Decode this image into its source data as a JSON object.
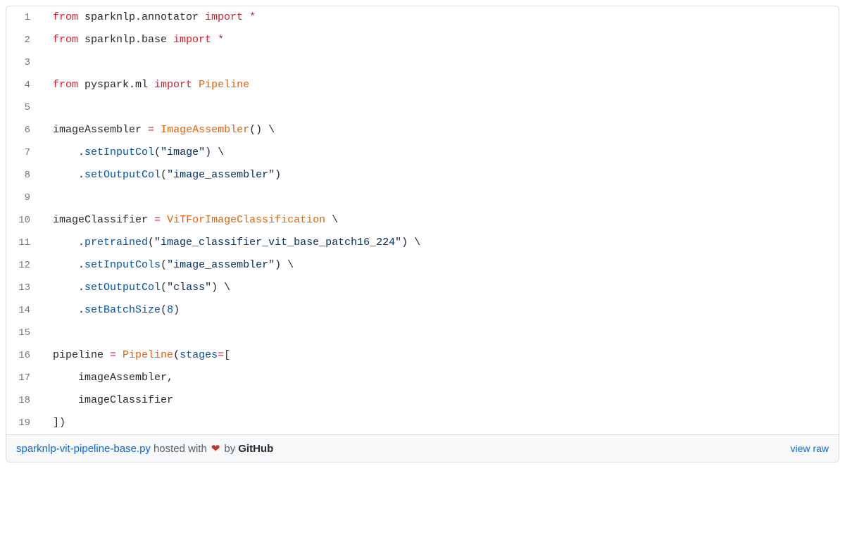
{
  "code": {
    "lines": [
      {
        "n": "1",
        "tokens": [
          {
            "t": "from",
            "c": "k-red"
          },
          {
            "t": " sparknlp.annotator "
          },
          {
            "t": "import",
            "c": "k-red"
          },
          {
            "t": " "
          },
          {
            "t": "*",
            "c": "k-red"
          }
        ]
      },
      {
        "n": "2",
        "tokens": [
          {
            "t": "from",
            "c": "k-red"
          },
          {
            "t": " sparknlp.base "
          },
          {
            "t": "import",
            "c": "k-red"
          },
          {
            "t": " "
          },
          {
            "t": "*",
            "c": "k-red"
          }
        ]
      },
      {
        "n": "3",
        "tokens": []
      },
      {
        "n": "4",
        "tokens": [
          {
            "t": "from",
            "c": "k-red"
          },
          {
            "t": " pyspark.ml "
          },
          {
            "t": "import",
            "c": "k-red"
          },
          {
            "t": " "
          },
          {
            "t": "Pipeline",
            "c": "k-orange"
          }
        ]
      },
      {
        "n": "5",
        "tokens": []
      },
      {
        "n": "6",
        "tokens": [
          {
            "t": "imageAssembler "
          },
          {
            "t": "=",
            "c": "k-red"
          },
          {
            "t": " "
          },
          {
            "t": "ImageAssembler",
            "c": "k-orange"
          },
          {
            "t": "() \\"
          }
        ]
      },
      {
        "n": "7",
        "tokens": [
          {
            "t": "    ."
          },
          {
            "t": "setInputCol",
            "c": "k-blue"
          },
          {
            "t": "("
          },
          {
            "t": "\"image\"",
            "c": "k-string"
          },
          {
            "t": ") \\"
          }
        ]
      },
      {
        "n": "8",
        "tokens": [
          {
            "t": "    ."
          },
          {
            "t": "setOutputCol",
            "c": "k-blue"
          },
          {
            "t": "("
          },
          {
            "t": "\"image_assembler\"",
            "c": "k-string"
          },
          {
            "t": ")"
          }
        ]
      },
      {
        "n": "9",
        "tokens": []
      },
      {
        "n": "10",
        "tokens": [
          {
            "t": "imageClassifier "
          },
          {
            "t": "=",
            "c": "k-red"
          },
          {
            "t": " "
          },
          {
            "t": "ViTForImageClassification",
            "c": "k-orange"
          },
          {
            "t": " \\"
          }
        ]
      },
      {
        "n": "11",
        "tokens": [
          {
            "t": "    ."
          },
          {
            "t": "pretrained",
            "c": "k-blue"
          },
          {
            "t": "("
          },
          {
            "t": "\"image_classifier_vit_base_patch16_224\"",
            "c": "k-string"
          },
          {
            "t": ") \\"
          }
        ]
      },
      {
        "n": "12",
        "tokens": [
          {
            "t": "    ."
          },
          {
            "t": "setInputCols",
            "c": "k-blue"
          },
          {
            "t": "("
          },
          {
            "t": "\"image_assembler\"",
            "c": "k-string"
          },
          {
            "t": ") \\"
          }
        ]
      },
      {
        "n": "13",
        "tokens": [
          {
            "t": "    ."
          },
          {
            "t": "setOutputCol",
            "c": "k-blue"
          },
          {
            "t": "("
          },
          {
            "t": "\"class\"",
            "c": "k-string"
          },
          {
            "t": ") \\"
          }
        ]
      },
      {
        "n": "14",
        "tokens": [
          {
            "t": "    ."
          },
          {
            "t": "setBatchSize",
            "c": "k-blue"
          },
          {
            "t": "("
          },
          {
            "t": "8",
            "c": "k-num"
          },
          {
            "t": ")"
          }
        ]
      },
      {
        "n": "15",
        "tokens": []
      },
      {
        "n": "16",
        "tokens": [
          {
            "t": "pipeline "
          },
          {
            "t": "=",
            "c": "k-red"
          },
          {
            "t": " "
          },
          {
            "t": "Pipeline",
            "c": "k-orange"
          },
          {
            "t": "("
          },
          {
            "t": "stages",
            "c": "k-blue"
          },
          {
            "t": "=",
            "c": "k-red"
          },
          {
            "t": "["
          }
        ]
      },
      {
        "n": "17",
        "tokens": [
          {
            "t": "    imageAssembler,"
          }
        ]
      },
      {
        "n": "18",
        "tokens": [
          {
            "t": "    imageClassifier"
          }
        ]
      },
      {
        "n": "19",
        "tokens": [
          {
            "t": "])"
          }
        ]
      }
    ]
  },
  "meta": {
    "filename": "sparknlp-vit-pipeline-base.py",
    "hosted_with": " hosted with ",
    "by": " by ",
    "heart": "❤",
    "github": "GitHub",
    "view_raw": "view raw"
  }
}
